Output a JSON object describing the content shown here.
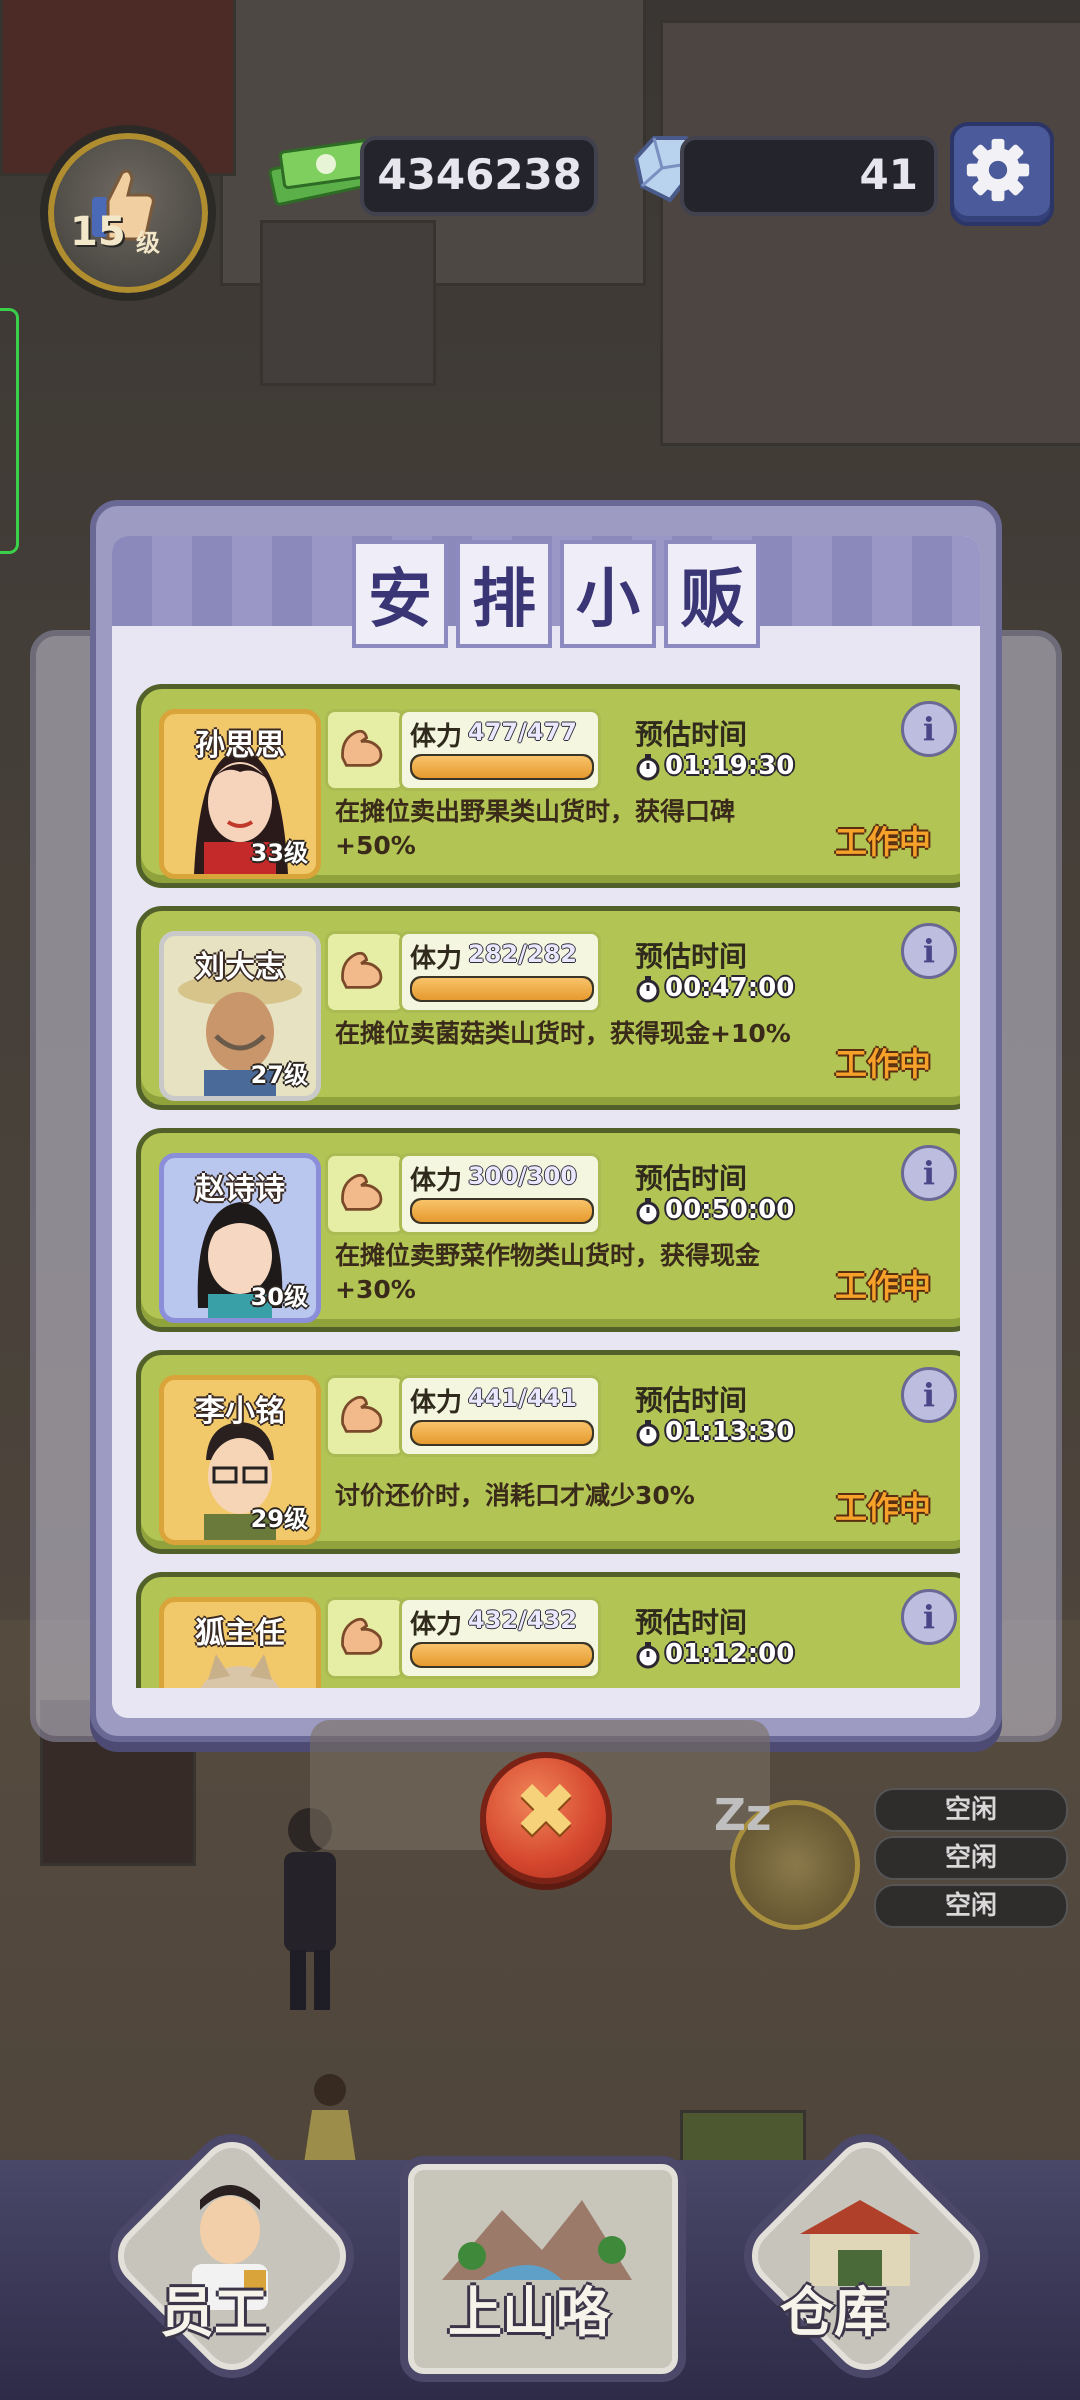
{
  "hud": {
    "level": "15",
    "level_unit": "级",
    "money": "4346238",
    "gems": "41"
  },
  "modal": {
    "title_chars": [
      "安",
      "排",
      "小",
      "贩"
    ]
  },
  "vendors": [
    {
      "name": "孙思思",
      "level": "33级",
      "stamina_label": "体力",
      "stamina": "477/477",
      "stamina_fraction": 1.0,
      "est_label": "预估时间",
      "est_time": "01:19:30",
      "desc": "在摊位卖出野果类山货时，获得口碑+50%",
      "status": "工作中",
      "frame": "gold"
    },
    {
      "name": "刘大志",
      "level": "27级",
      "stamina_label": "体力",
      "stamina": "282/282",
      "stamina_fraction": 1.0,
      "est_label": "预估时间",
      "est_time": "00:47:00",
      "desc": "在摊位卖菌菇类山货时，获得现金+10%",
      "status": "工作中",
      "frame": "silver"
    },
    {
      "name": "赵诗诗",
      "level": "30级",
      "stamina_label": "体力",
      "stamina": "300/300",
      "stamina_fraction": 1.0,
      "est_label": "预估时间",
      "est_time": "00:50:00",
      "desc": "在摊位卖野菜作物类山货时，获得现金+30%",
      "status": "工作中",
      "frame": "blue"
    },
    {
      "name": "李小铭",
      "level": "29级",
      "stamina_label": "体力",
      "stamina": "441/441",
      "stamina_fraction": 1.0,
      "est_label": "预估时间",
      "est_time": "01:13:30",
      "desc": "讨价还价时，消耗口才减少30%",
      "status": "工作中",
      "frame": "gold"
    },
    {
      "name": "狐主任",
      "level": "",
      "stamina_label": "体力",
      "stamina": "432/432",
      "stamina_fraction": 1.0,
      "est_label": "预估时间",
      "est_time": "01:12:00",
      "desc": "",
      "status": "",
      "frame": "gold"
    }
  ],
  "idle_chips": [
    "空闲",
    "空闲",
    "空闲"
  ],
  "idle_zz": "Zz",
  "nav": {
    "staff": "员工",
    "mountain": "上山咯",
    "warehouse": "仓库"
  },
  "colors": {
    "card_green": "#b2c454",
    "status_orange": "#f6a12a",
    "modal_purple": "#9d9bc1",
    "close_red": "#d5462e"
  }
}
